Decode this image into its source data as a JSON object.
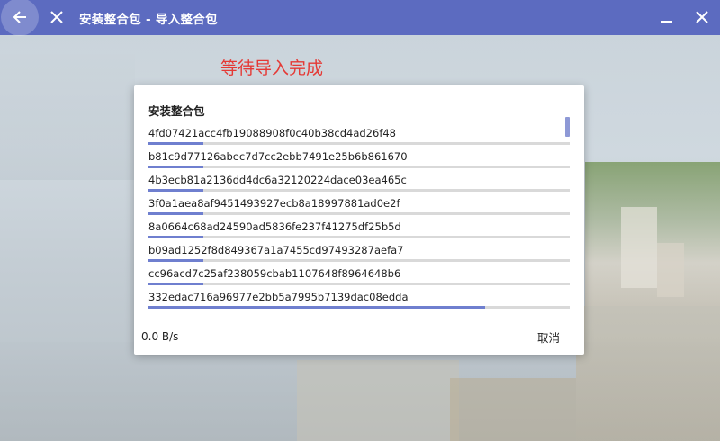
{
  "window": {
    "title": "安装整合包 - 导入整合包",
    "back_icon": "arrow-left-icon",
    "close_icon": "close-icon",
    "minimize_icon": "minimize-icon",
    "window_close_icon": "close-icon",
    "titlebar_color": "#5c6bc0"
  },
  "annotation": {
    "text": "等待导入完成",
    "color": "#e53935"
  },
  "dialog": {
    "title": "安装整合包",
    "tasks": [
      {
        "name": "4fd07421acc4fb19088908f0c40b38cd4ad26f48",
        "progress": 0.13
      },
      {
        "name": "b81c9d77126abec7d7cc2ebb7491e25b6b861670",
        "progress": 0.13
      },
      {
        "name": "4b3ecb81a2136dd4dc6a32120224dace03ea465c",
        "progress": 0.13
      },
      {
        "name": "3f0a1aea8af9451493927ecb8a18997881ad0e2f",
        "progress": 0.13
      },
      {
        "name": "8a0664c68ad24590ad5836fe237f41275df25b5d",
        "progress": 0.13
      },
      {
        "name": "b09ad1252f8d849367a1a7455cd97493287aefa7",
        "progress": 0.13
      },
      {
        "name": "cc96acd7c25af238059cbab1107648f8964648b6",
        "progress": 0.13
      },
      {
        "name": "332edac716a96977e2bb5a7995b7139dac08edda",
        "progress": 0.8
      }
    ],
    "speed": "0.0 B/s",
    "cancel_label": "取消",
    "accent_color": "#6f7fcf"
  }
}
